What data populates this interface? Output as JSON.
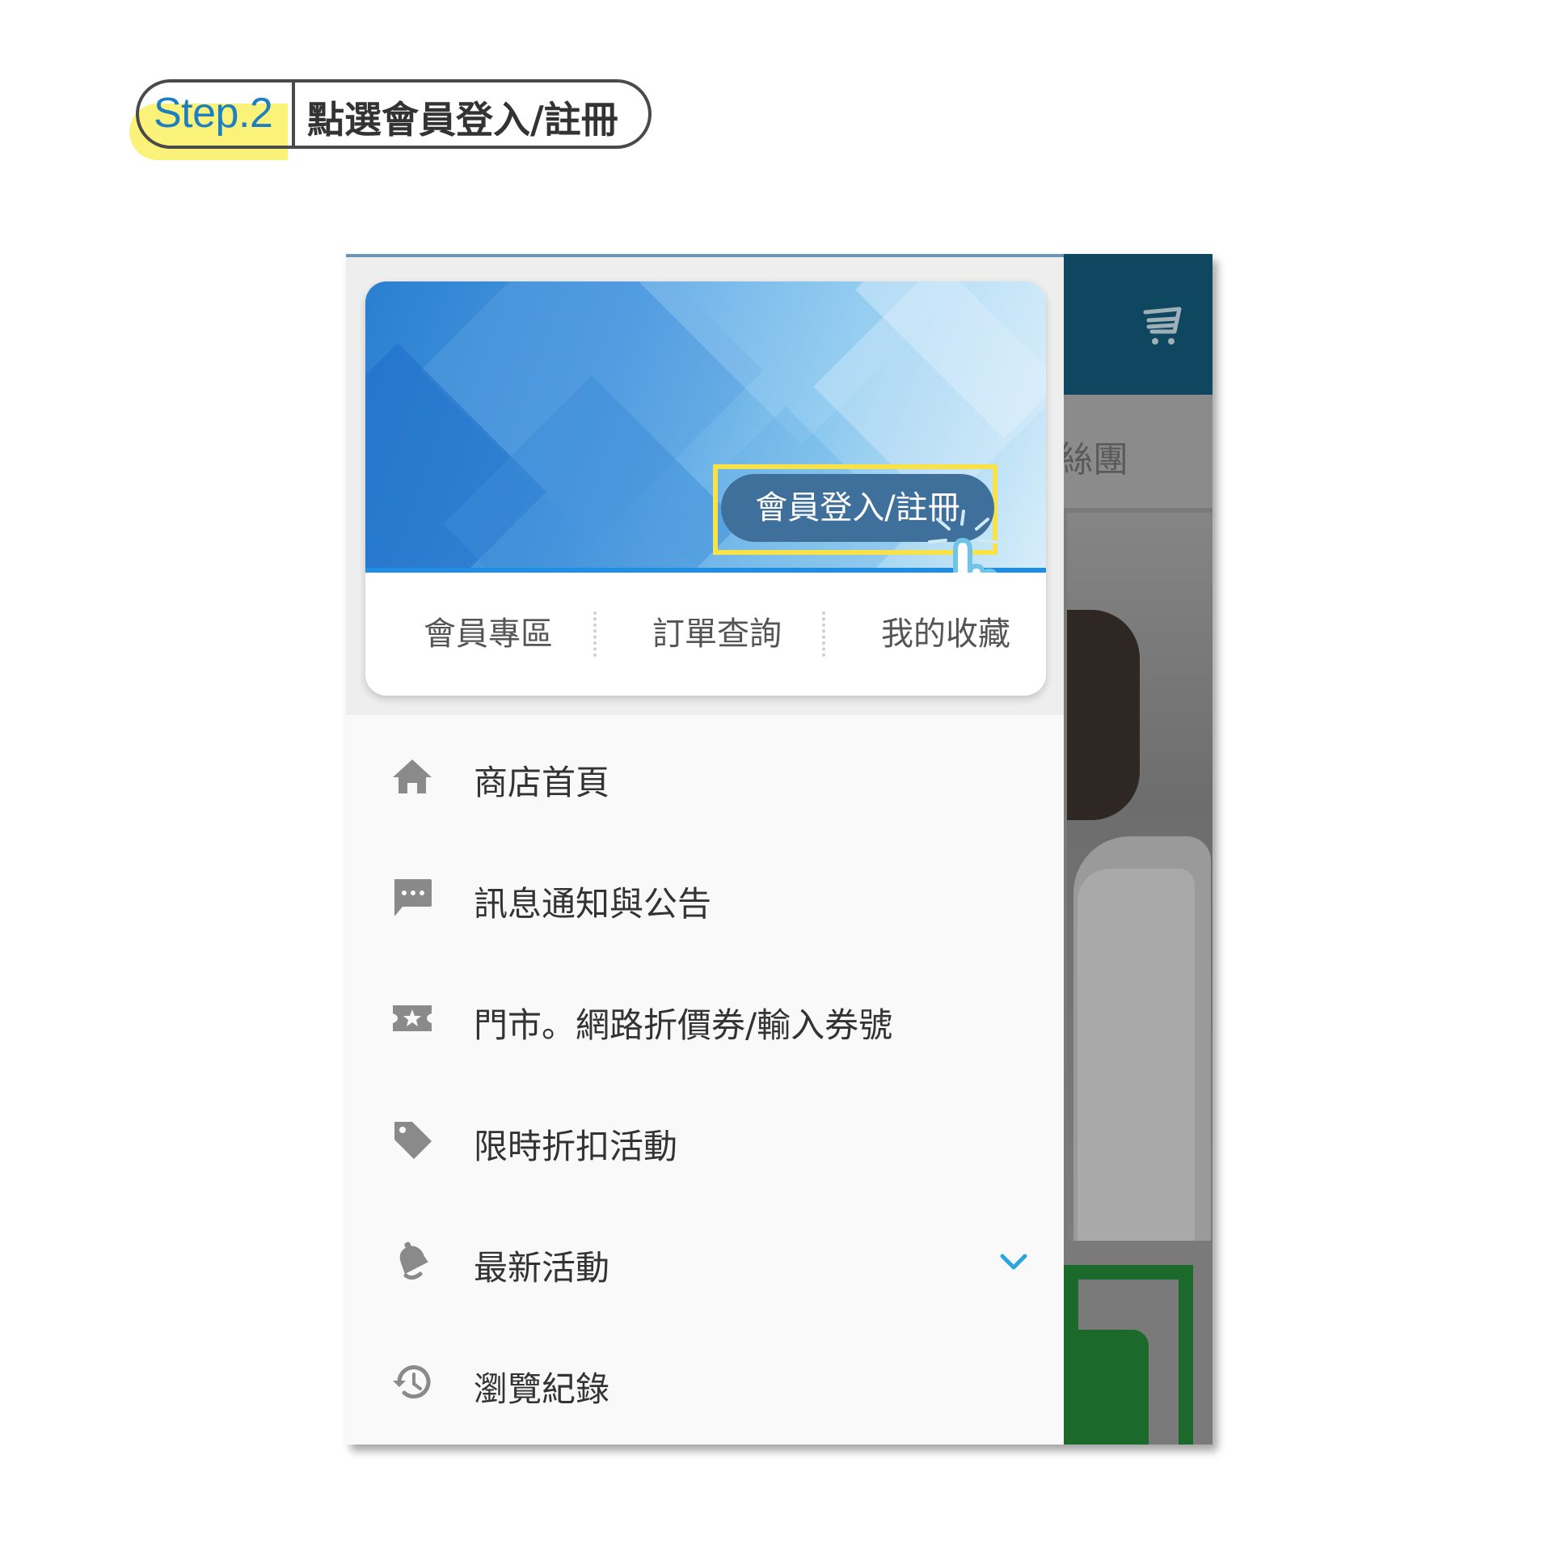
{
  "step": {
    "number": "Step.2",
    "instruction": "點選會員登入/註冊"
  },
  "background_app": {
    "tab_partial": "絲團",
    "icons": [
      "cart-icon"
    ]
  },
  "drawer": {
    "login_button": "會員登入/註冊",
    "quick_links": [
      {
        "label": "會員專區"
      },
      {
        "label": "訂單查詢"
      },
      {
        "label": "我的收藏"
      }
    ],
    "menu": [
      {
        "icon": "home-icon",
        "label": "商店首頁"
      },
      {
        "icon": "message-icon",
        "label": "訊息通知與公告"
      },
      {
        "icon": "ticket-icon",
        "label": "門市。網路折價券/輸入券號"
      },
      {
        "icon": "tag-icon",
        "label": "限時折扣活動"
      },
      {
        "icon": "bell-icon",
        "label": "最新活動",
        "expandable": true
      },
      {
        "icon": "history-icon",
        "label": "瀏覽紀錄"
      }
    ]
  },
  "colors": {
    "accent_blue": "#1d7fc1",
    "highlight_yellow": "#f7e24a",
    "topbar": "#0f4761",
    "chevron": "#2ba4e0"
  }
}
